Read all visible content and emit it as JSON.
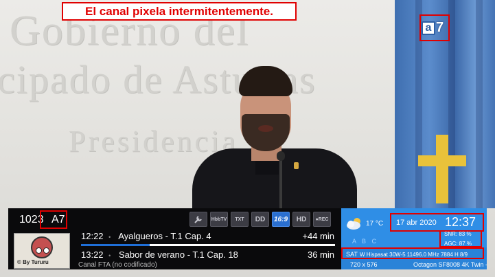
{
  "caption": "El canal pixela intermitentemente.",
  "backdrop": {
    "wall_lines": [
      "Gobierno del",
      "cipado de Asturias",
      "Presidencia"
    ]
  },
  "channel_logo": {
    "letter": "a",
    "number": "7"
  },
  "infobar": {
    "channel_number": "1023",
    "channel_name": "A7",
    "icons": [
      "wrench-icon",
      "hbbtv-icon",
      "teletext-icon",
      "dolby-icon",
      "aspect-16-9-icon",
      "hd-icon",
      "rec-icon"
    ],
    "icon_labels": {
      "hbbtv": "HbbTV",
      "txt": "TXT",
      "dolby": "DD",
      "aspect": "16:9",
      "hd": "HD",
      "rec": "●REC"
    },
    "thumbnail_tag": "© By Tururu",
    "events": [
      {
        "time": "12:22",
        "title": "Ayalgueros -",
        "episode": "T.1 Cap. 4",
        "remaining": "+44 min"
      },
      {
        "time": "13:22",
        "title": "Sabor de verano -",
        "episode": "T.1 Cap. 18",
        "remaining": "36 min"
      }
    ],
    "progress_fraction": 0.27,
    "encryption": "Canal FTA (no codificado)"
  },
  "status_panel": {
    "weather_icon": "cloud-sun-icon",
    "temperature": "17 °C",
    "date": "17 abr 2020",
    "time": "12:37",
    "abc": "A B C",
    "snr": "SNR:  83 %",
    "agc": "AGC:  87 %",
    "sat_label": "SAT",
    "sat_info": "W Hispasat 30W-5 11496.0 MHz 7884 H 8/9",
    "resolution": "720 x 576",
    "receiver": "Octagon SF8008 4K Twin -"
  },
  "colors": {
    "callout": "#e00000",
    "panel_blue": "#2f8ee6",
    "progress": "#1f6fd8"
  }
}
